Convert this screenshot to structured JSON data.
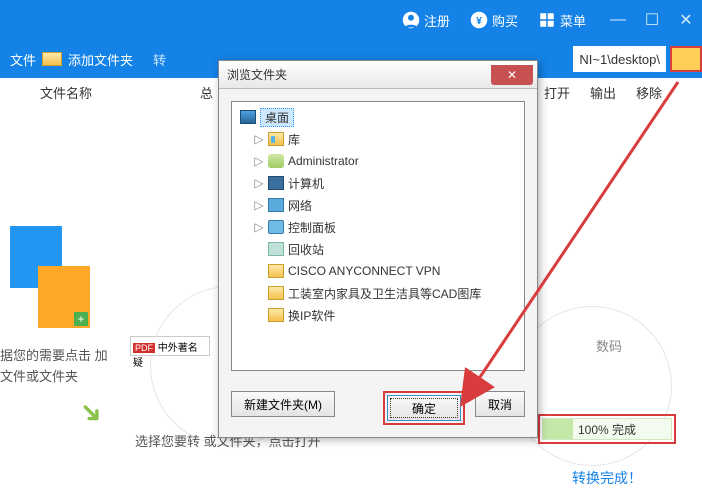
{
  "titlebar": {
    "register": "注册",
    "buy": "购买",
    "menu": "菜单"
  },
  "toolbar": {
    "add_file": "文件",
    "add_folder": "添加文件夹",
    "path": "NI~1\\desktop\\"
  },
  "columns": {
    "name": "文件名称",
    "total": "总",
    "open": "打开",
    "output": "输出",
    "remove": "移除"
  },
  "hints": {
    "drop": "据您的需要点击\n加文件或文件夹",
    "select": "选择您要转\n或文件夹，点击打开",
    "thumb_label": "中外著名疑",
    "pdf_badge": "PDF",
    "digital": "数码",
    "progress_pct": "100%",
    "progress_done": "完成",
    "conversion_done": "转换完成！"
  },
  "dialog": {
    "title": "浏览文件夹",
    "tree": {
      "root": "桌面",
      "items": [
        {
          "icon": "lib",
          "label": "库"
        },
        {
          "icon": "user",
          "label": "Administrator"
        },
        {
          "icon": "computer",
          "label": "计算机"
        },
        {
          "icon": "network",
          "label": "网络"
        },
        {
          "icon": "control",
          "label": "控制面板"
        },
        {
          "icon": "recycle",
          "label": "回收站"
        },
        {
          "icon": "folder",
          "label": "CISCO ANYCONNECT VPN"
        },
        {
          "icon": "folder",
          "label": "工装室内家具及卫生洁具等CAD图库"
        },
        {
          "icon": "folder",
          "label": "换IP软件"
        }
      ]
    },
    "new_folder": "新建文件夹(M)",
    "ok": "确定",
    "cancel": "取消"
  }
}
